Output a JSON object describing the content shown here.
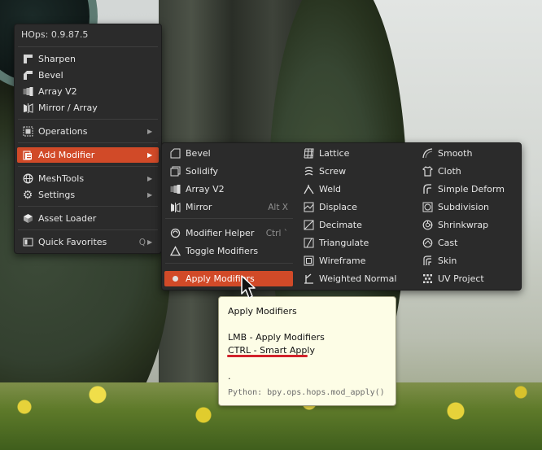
{
  "menu": {
    "title": "HOps: 0.9.87.5",
    "quick": [
      {
        "label": "Sharpen",
        "icon": "sharpen-icon"
      },
      {
        "label": "Bevel",
        "icon": "bevel-icon"
      },
      {
        "label": "Array V2",
        "icon": "array-icon"
      },
      {
        "label": "Mirror / Array",
        "icon": "mirror-icon"
      }
    ],
    "operations": "Operations",
    "add_modifier": "Add Modifier",
    "meshtools": "MeshTools",
    "settings": "Settings",
    "asset_loader": "Asset Loader",
    "quick_favorites": "Quick Favorites",
    "quick_favorites_shortcut": "Q"
  },
  "submenu": {
    "col1": {
      "bevel": "Bevel",
      "solidify": "Solidify",
      "array": "Array V2",
      "mirror": "Mirror",
      "mirror_shortcut": "Alt X",
      "modifier_helper": "Modifier Helper",
      "modifier_helper_shortcut": "Ctrl `",
      "toggle_modifiers": "Toggle Modifiers",
      "apply_modifiers": "Apply Modifiers"
    },
    "col2": [
      "Lattice",
      "Screw",
      "Weld",
      "Displace",
      "Decimate",
      "Triangulate",
      "Wireframe",
      "Weighted Normal"
    ],
    "col3": [
      "Smooth",
      "Cloth",
      "Simple Deform",
      "Subdivision",
      "Shrinkwrap",
      "Cast",
      "Skin",
      "UV Project"
    ]
  },
  "tooltip": {
    "title": "Apply Modifiers",
    "lmb": "LMB - Apply Modifiers",
    "ctrl": "CTRL - Smart Apply",
    "dot": ".",
    "python": "Python: bpy.ops.hops.mod_apply()"
  },
  "colors": {
    "menu_bg": "#2b2b2b",
    "highlight": "#d14a28",
    "tooltip_bg": "#fdfde6",
    "annotation": "#d2222b"
  }
}
